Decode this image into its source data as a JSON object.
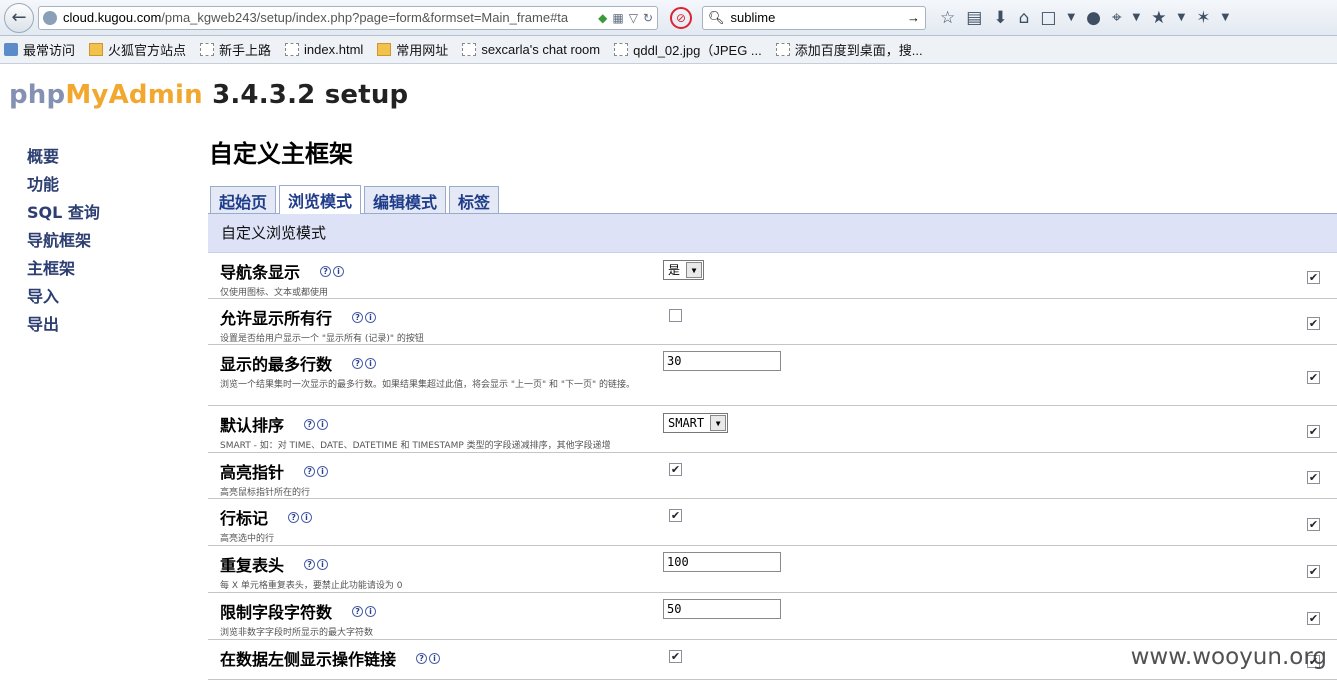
{
  "browser": {
    "url_host": "cloud.kugou.com",
    "url_path": "/pma_kgweb243/setup/index.php?page=form&formset=Main_frame#ta",
    "search_value": "sublime"
  },
  "bookmarks": [
    "最常访问",
    "火狐官方站点",
    "新手上路",
    "index.html",
    "常用网址",
    "sexcarla's chat room",
    "qddl_02.jpg（JPEG ...",
    "添加百度到桌面，搜..."
  ],
  "app": {
    "title_php": "php",
    "title_my": "MyAdmin",
    "title_rest": " 3.4.3.2 setup"
  },
  "sidebar": [
    "概要",
    "功能",
    "SQL 查询",
    "导航框架",
    "主框架",
    "导入",
    "导出"
  ],
  "page_title": "自定义主框架",
  "tabs": [
    "起始页",
    "浏览模式",
    "编辑模式",
    "标签"
  ],
  "active_tab": 1,
  "section_title": "自定义浏览模式",
  "help_icons": {
    "doc": "?",
    "info": "i"
  },
  "rows": [
    {
      "title": "导航条显示",
      "desc": "仅使用图标、文本或都使用",
      "control": "select",
      "value": "是",
      "default_checked": true
    },
    {
      "title": "允许显示所有行",
      "desc": "设置是否给用户显示一个 \"显示所有 (记录)\" 的按钮",
      "control": "checkbox",
      "checked": false,
      "default_checked": true
    },
    {
      "title": "显示的最多行数",
      "desc": "浏览一个结果集时一次显示的最多行数。如果结果集超过此值，将会显示 \"上一页\" 和 \"下一页\" 的链接。",
      "control": "text",
      "value": "30",
      "default_checked": true
    },
    {
      "title": "默认排序",
      "desc": "SMART - 如：对 TIME、DATE、DATETIME 和 TIMESTAMP 类型的字段递减排序，其他字段递增",
      "control": "select",
      "value": "SMART",
      "default_checked": true
    },
    {
      "title": "高亮指针",
      "desc": "高亮鼠标指针所在的行",
      "control": "checkbox",
      "checked": true,
      "default_checked": true
    },
    {
      "title": "行标记",
      "desc": "高亮选中的行",
      "control": "checkbox",
      "checked": true,
      "default_checked": true
    },
    {
      "title": "重复表头",
      "desc": "每 X 单元格重复表头，要禁止此功能请设为 0",
      "control": "text",
      "value": "100",
      "default_checked": true
    },
    {
      "title": "限制字段字符数",
      "desc": "浏览非数字字段时所显示的最大字符数",
      "control": "text",
      "value": "50",
      "default_checked": true
    },
    {
      "title": "在数据左侧显示操作链接",
      "desc": "",
      "control": "checkbox",
      "checked": true,
      "default_checked": true
    }
  ],
  "watermark": "www.wooyun.org"
}
